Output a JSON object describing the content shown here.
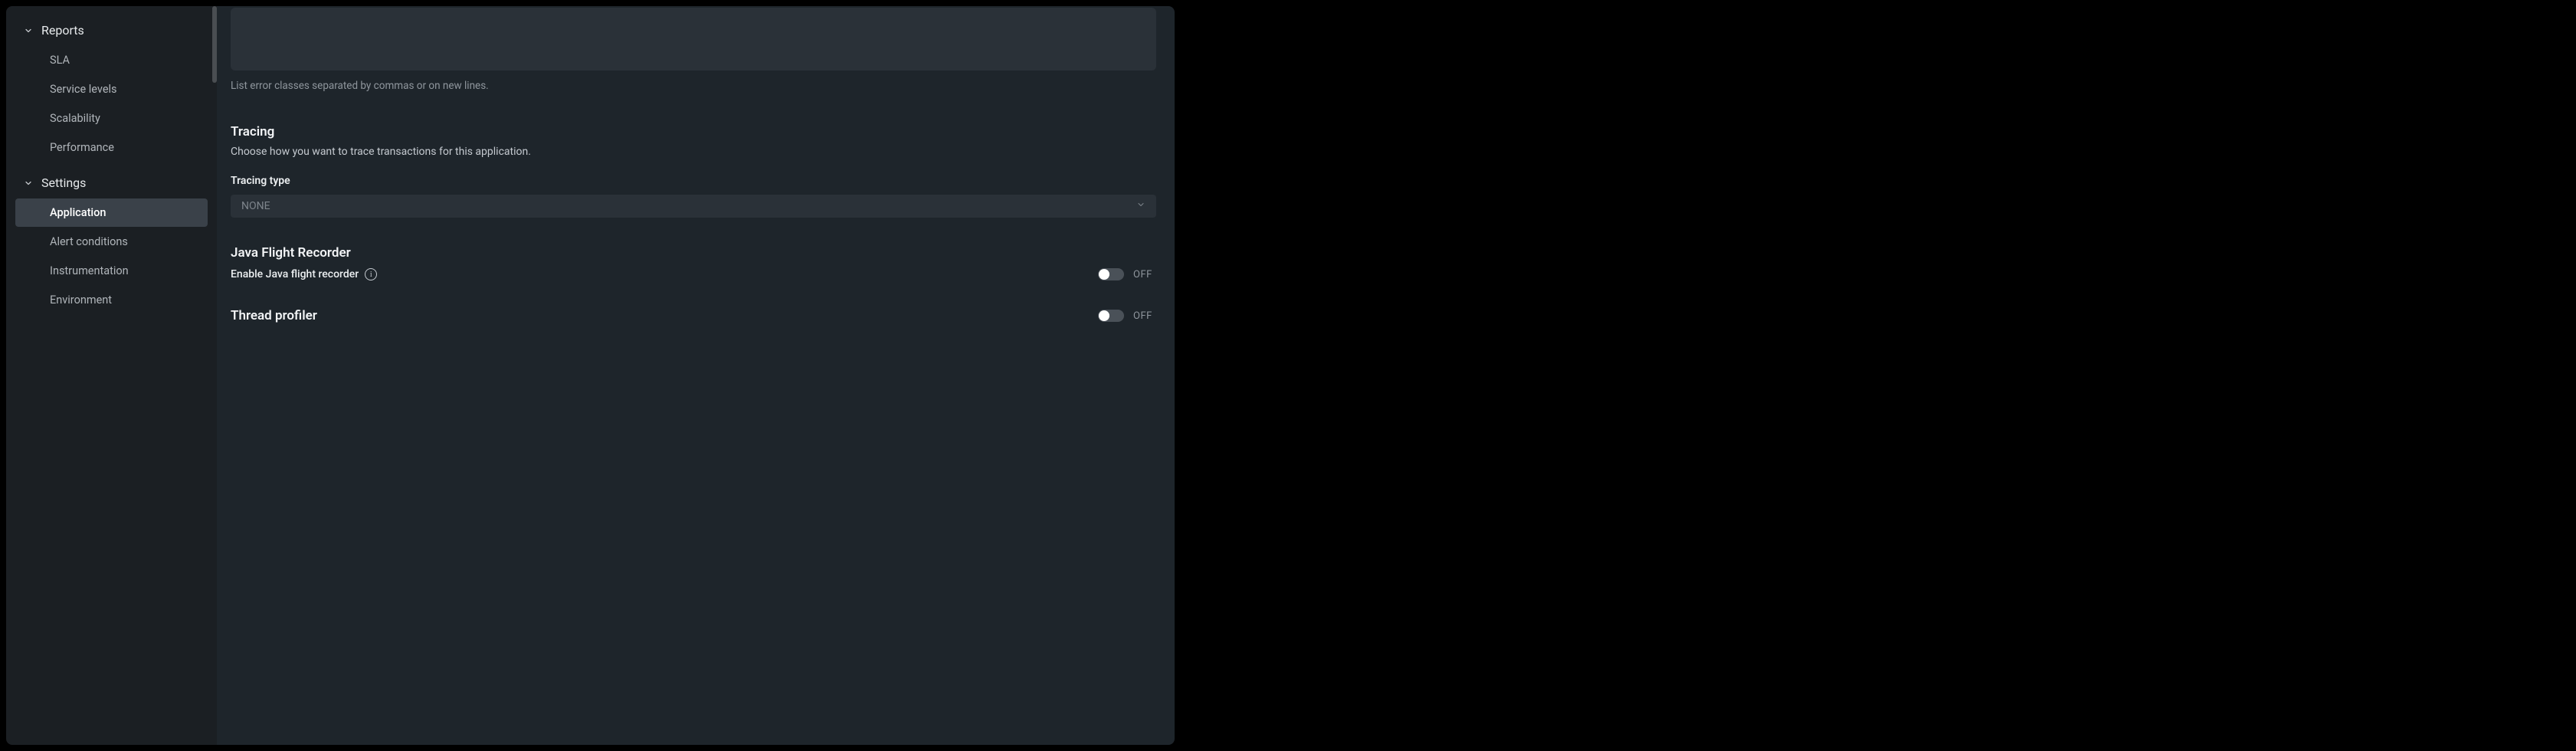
{
  "sidebar": {
    "groups": [
      {
        "label": "Reports",
        "items": [
          {
            "label": "SLA"
          },
          {
            "label": "Service levels"
          },
          {
            "label": "Scalability"
          },
          {
            "label": "Performance"
          }
        ]
      },
      {
        "label": "Settings",
        "items": [
          {
            "label": "Application",
            "active": true
          },
          {
            "label": "Alert conditions"
          },
          {
            "label": "Instrumentation"
          },
          {
            "label": "Environment"
          }
        ]
      }
    ]
  },
  "main": {
    "error_classes": {
      "helper": "List error classes separated by commas or on new lines."
    },
    "tracing": {
      "title": "Tracing",
      "description": "Choose how you want to trace transactions for this application.",
      "type_label": "Tracing type",
      "type_value": "NONE"
    },
    "jfr": {
      "title": "Java Flight Recorder",
      "toggle_label": "Enable Java flight recorder",
      "toggle_state": "OFF"
    },
    "thread_profiler": {
      "title": "Thread profiler",
      "toggle_state": "OFF"
    }
  },
  "icons": {
    "info_glyph": "i"
  }
}
